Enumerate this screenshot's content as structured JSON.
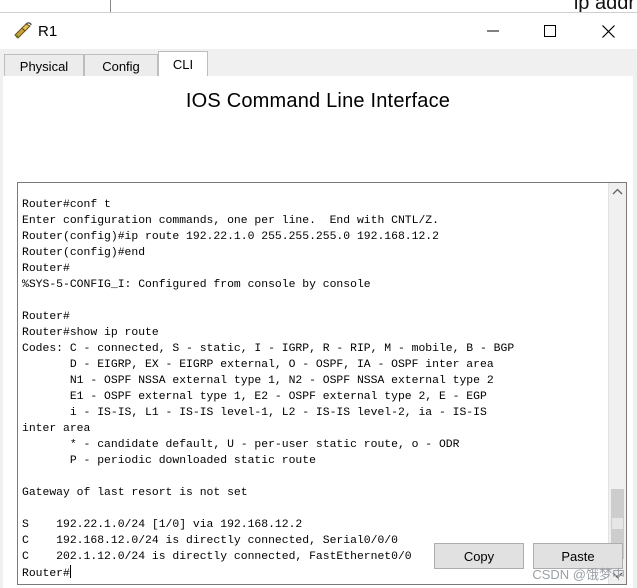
{
  "background_text": "ip addr",
  "window": {
    "title": "R1",
    "controls": [
      "minimize",
      "maximize",
      "close"
    ]
  },
  "tabs": [
    {
      "label": "Physical",
      "active": false
    },
    {
      "label": "Config",
      "active": false
    },
    {
      "label": "CLI",
      "active": true
    }
  ],
  "cli": {
    "heading": "IOS Command Line Interface",
    "output": "Router#conf t\nEnter configuration commands, one per line.  End with CNTL/Z.\nRouter(config)#ip route 192.22.1.0 255.255.255.0 192.168.12.2\nRouter(config)#end\nRouter#\n%SYS-5-CONFIG_I: Configured from console by console\n\nRouter#\nRouter#show ip route\nCodes: C - connected, S - static, I - IGRP, R - RIP, M - mobile, B - BGP\n       D - EIGRP, EX - EIGRP external, O - OSPF, IA - OSPF inter area\n       N1 - OSPF NSSA external type 1, N2 - OSPF NSSA external type 2\n       E1 - OSPF external type 1, E2 - OSPF external type 2, E - EGP\n       i - IS-IS, L1 - IS-IS level-1, L2 - IS-IS level-2, ia - IS-IS\ninter area\n       * - candidate default, U - per-user static route, o - ODR\n       P - periodic downloaded static route\n\nGateway of last resort is not set\n\nS    192.22.1.0/24 [1/0] via 192.168.12.2\nC    192.168.12.0/24 is directly connected, Serial0/0/0\nC    202.1.12.0/24 is directly connected, FastEthernet0/0\n",
    "prompt": "Router#"
  },
  "buttons": {
    "copy": "Copy",
    "paste": "Paste"
  },
  "watermark": "CSDN @饿梦中",
  "colors": {
    "window_bg": "#f0f0f0",
    "terminal_border": "#7a7a7a",
    "button_bg": "#e1e1e1"
  }
}
